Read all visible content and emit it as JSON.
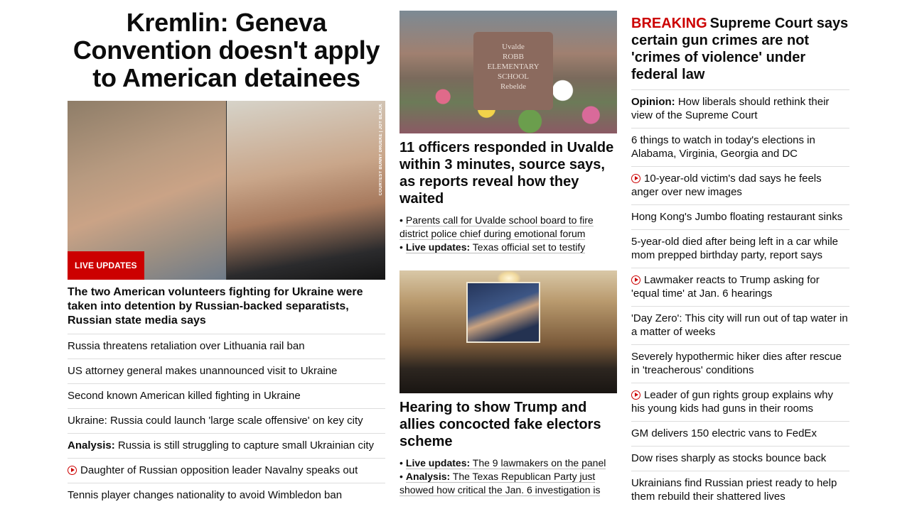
{
  "col1": {
    "hero_title": "Kremlin: Geneva Convention doesn't apply to American detainees",
    "photo_credit": "COURTESY BUNNY DRUEKE | JOY BLACK",
    "live_badge": "LIVE UPDATES",
    "hero_sub": "The two American volunteers fighting for Ukraine were taken into detention by Russian-backed separatists, Russian state media says",
    "links": [
      {
        "tag": "",
        "text": "Russia threatens retaliation over Lithuania rail ban",
        "icon": ""
      },
      {
        "tag": "",
        "text": "US attorney general makes unannounced visit to Ukraine",
        "icon": ""
      },
      {
        "tag": "",
        "text": "Second known American killed fighting in Ukraine",
        "icon": ""
      },
      {
        "tag": "",
        "text": "Ukraine: Russia could launch 'large scale offensive' on key city",
        "icon": ""
      },
      {
        "tag": "Analysis:",
        "text": "Russia is still struggling to capture small Ukrainian city",
        "icon": ""
      },
      {
        "tag": "",
        "text": "Daughter of Russian opposition leader Navalny speaks out",
        "icon": "play-icon"
      },
      {
        "tag": "",
        "text": "Tennis player changes nationality to avoid Wimbledon ban",
        "icon": ""
      }
    ]
  },
  "col2": {
    "story1": {
      "sign_text": [
        "Uvalde",
        "ROBB",
        "ELEMENTARY",
        "SCHOOL",
        "Rebelde"
      ],
      "title": "11 officers responded in Uvalde within 3 minutes, source says, as reports reveal how they waited",
      "bullets": [
        {
          "tag": "",
          "text": "Parents call for Uvalde school board to fire district police chief during emotional forum"
        },
        {
          "tag": "Live updates:",
          "text": "Texas official set to testify"
        }
      ]
    },
    "story2": {
      "title": "Hearing to show Trump and allies concocted fake electors scheme",
      "bullets": [
        {
          "tag": "Live updates:",
          "text": "The 9 lawmakers on the panel"
        },
        {
          "tag": "Analysis:",
          "text": "The Texas Republican Party just showed how critical the Jan. 6 investigation is"
        }
      ]
    }
  },
  "col3": {
    "breaking_label": "BREAKING",
    "breaking_title": "Supreme Court says certain gun crimes are not 'crimes of violence' under federal law",
    "links": [
      {
        "tag": "Opinion:",
        "text": "How liberals should rethink their view of the Supreme Court",
        "icon": ""
      },
      {
        "tag": "",
        "text": "6 things to watch in today's elections in Alabama, Virginia, Georgia and DC",
        "icon": ""
      },
      {
        "tag": "",
        "text": "10-year-old victim's dad says he feels anger over new images",
        "icon": "play-icon"
      },
      {
        "tag": "",
        "text": "Hong Kong's Jumbo floating restaurant sinks",
        "icon": ""
      },
      {
        "tag": "",
        "text": "5-year-old died after being left in a car while mom prepped birthday party, report says",
        "icon": ""
      },
      {
        "tag": "",
        "text": "Lawmaker reacts to Trump asking for 'equal time' at Jan. 6 hearings",
        "icon": "play-icon"
      },
      {
        "tag": "",
        "text": "'Day Zero': This city will run out of tap water in a matter of weeks",
        "icon": ""
      },
      {
        "tag": "",
        "text": "Severely hypothermic hiker dies after rescue in 'treacherous' conditions",
        "icon": ""
      },
      {
        "tag": "",
        "text": "Leader of gun rights group explains why his young kids had guns in their rooms",
        "icon": "play-icon"
      },
      {
        "tag": "",
        "text": "GM delivers 150 electric vans to FedEx",
        "icon": ""
      },
      {
        "tag": "",
        "text": "Dow rises sharply as stocks bounce back",
        "icon": ""
      },
      {
        "tag": "",
        "text": "Ukrainians find Russian priest ready to help them rebuild their shattered lives",
        "icon": ""
      }
    ]
  },
  "colors": {
    "accent_red": "#cc0000",
    "divider": "#dddddd",
    "text": "#0c0c0c"
  }
}
